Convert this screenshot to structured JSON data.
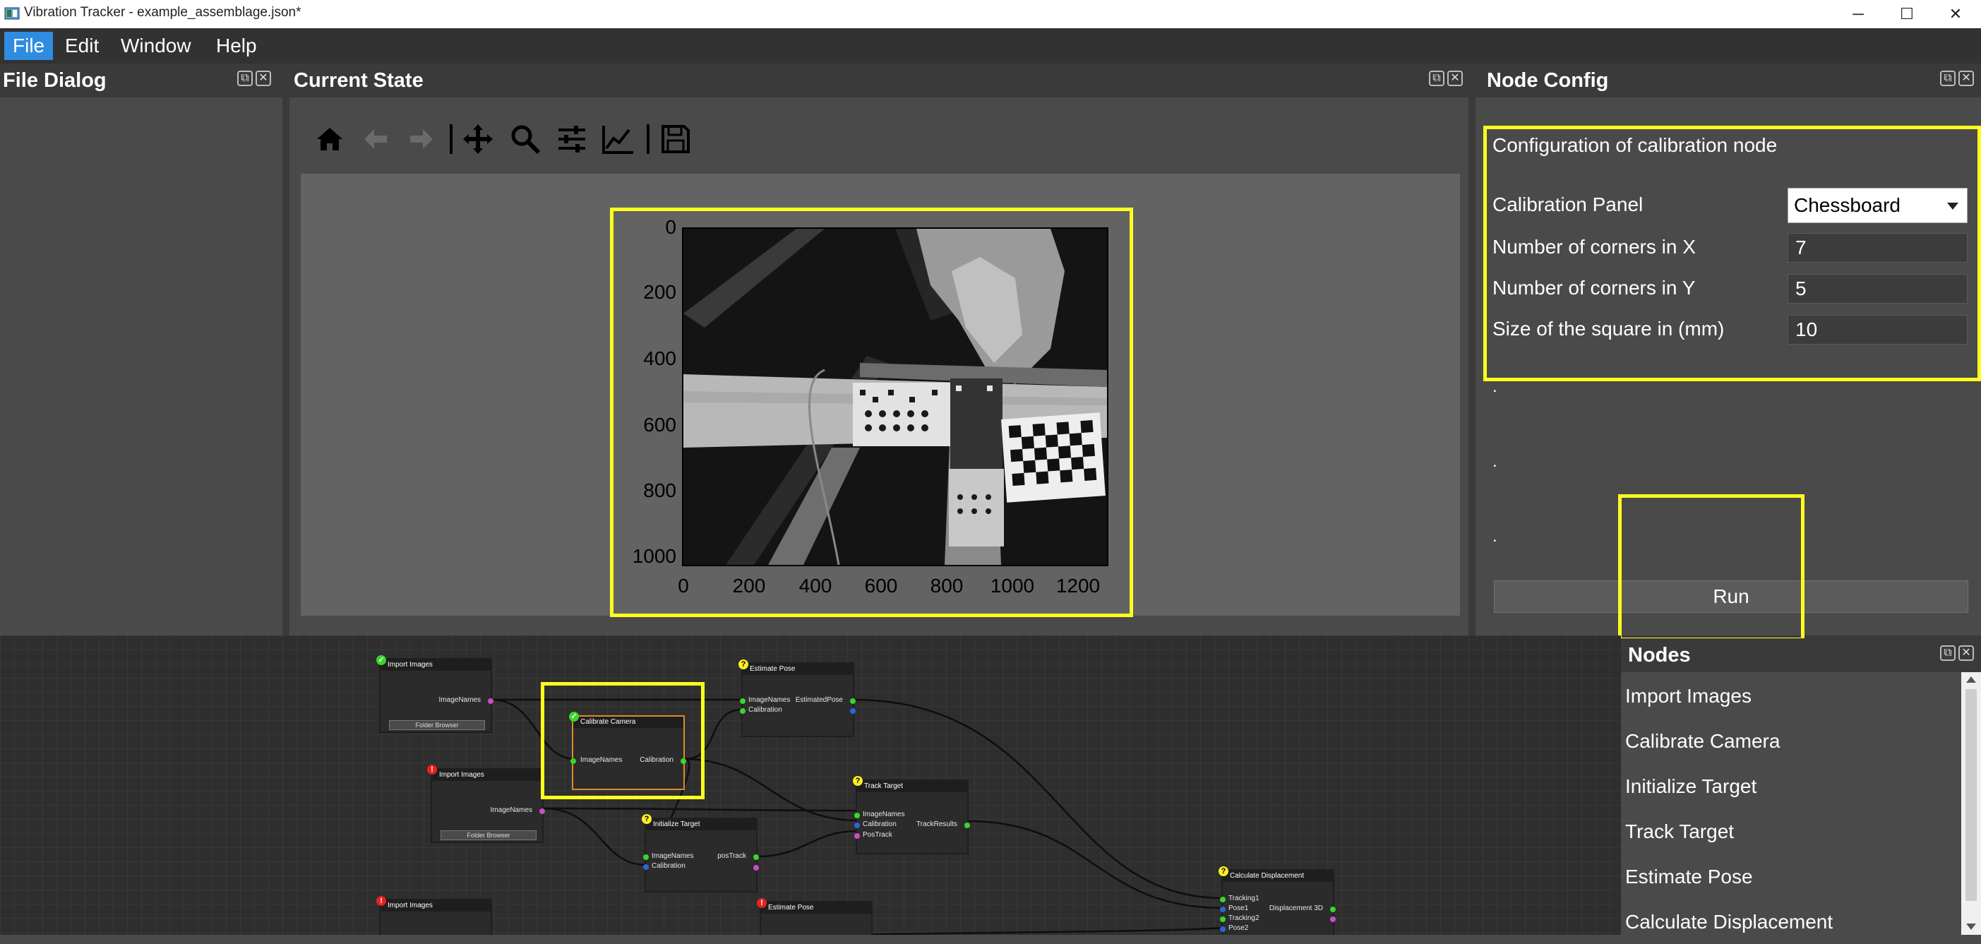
{
  "window": {
    "title": "Vibration Tracker - example_assemblage.json*",
    "minimize": "─",
    "maximize": "☐",
    "close": "✕"
  },
  "menu": {
    "file": "File",
    "edit": "Edit",
    "window": "Window",
    "help": "Help"
  },
  "panels": {
    "file_dialog": "File Dialog",
    "current_state": "Current State",
    "node_config": "Node Config",
    "nodes": "Nodes"
  },
  "toolbar_icons": [
    "home-icon",
    "back-arrow-icon",
    "forward-arrow-icon",
    "pan-icon",
    "zoom-icon",
    "configure-subplots-icon",
    "edit-axis-icon",
    "save-icon"
  ],
  "plot": {
    "y_ticks": [
      "0",
      "200",
      "400",
      "600",
      "800",
      "1000"
    ],
    "x_ticks": [
      "0",
      "200",
      "400",
      "600",
      "800",
      "1000",
      "1200"
    ]
  },
  "node_config": {
    "heading": "Configuration of calibration node",
    "calibration_panel_label": "Calibration Panel",
    "calibration_panel_value": "Chessboard",
    "corners_x_label": "Number of corners in X",
    "corners_x_value": "7",
    "corners_y_label": "Number of corners in Y",
    "corners_y_value": "5",
    "square_size_label": "Size of the square in (mm)",
    "square_size_value": "10",
    "dots": [
      ".",
      ".",
      "."
    ],
    "run_label": "Run"
  },
  "node_list": [
    "Import Images",
    "Calibrate Camera",
    "Initialize Target",
    "Track Target",
    "Estimate Pose",
    "Calculate Displacement"
  ],
  "graph": {
    "import1": {
      "title": "Import Images",
      "out": "ImageNames",
      "button": "Folder Browser",
      "status": "✓"
    },
    "import2": {
      "title": "Import Images",
      "out": "ImageNames",
      "button": "Folder Browser",
      "status": "!"
    },
    "import3": {
      "title": "Import Images",
      "status": "!"
    },
    "calibrate": {
      "title": "Calibrate Camera",
      "in": "ImageNames",
      "out": "Calibration",
      "status": "✓"
    },
    "estimate1": {
      "title": "Estimate Pose",
      "in1": "ImageNames",
      "in2": "Calibration",
      "out": "EstimatedPose",
      "status": "?"
    },
    "estimate2": {
      "title": "Estimate Pose",
      "status": "!"
    },
    "track": {
      "title": "Track Target",
      "in1": "ImageNames",
      "in2": "Calibration",
      "in3": "PosTrack",
      "out": "TrackResults",
      "status": "?"
    },
    "init": {
      "title": "Initialize Target",
      "in1": "ImageNames",
      "in2": "Calibration",
      "out": "posTrack",
      "status": "?"
    },
    "displacement": {
      "title": "Calculate Displacement",
      "in1": "Tracking1",
      "in2": "Pose1",
      "in3": "Tracking2",
      "in4": "Pose2",
      "out": "Displacement 3D",
      "status": "?"
    }
  },
  "colors": {
    "accent": "#2f8ce0",
    "highlight": "#ffff1e",
    "port_green": "#39d72b",
    "port_blue": "#2a66d9",
    "port_magenta": "#c84fc8"
  }
}
